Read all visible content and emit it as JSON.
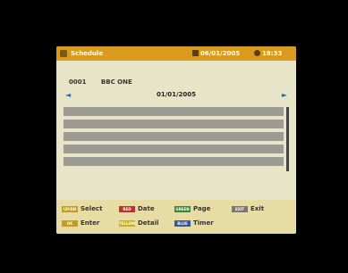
{
  "header": {
    "title": "Schedule",
    "date": "06/01/2005",
    "time": "18:33"
  },
  "channel": {
    "number": "0001",
    "name": "BBC ONE"
  },
  "date_nav": {
    "left_arrow": "◄",
    "date": "01/01/2005",
    "right_arrow": "►"
  },
  "schedule": {
    "rows": [
      "",
      "",
      "",
      "",
      "",
      ""
    ]
  },
  "legend": {
    "select": {
      "badge": "UP/DN",
      "label": "Select"
    },
    "date": {
      "badge": "RED",
      "label": "Date"
    },
    "page": {
      "badge": "GREEN",
      "label": "Page"
    },
    "exit": {
      "badge": "EXIT",
      "label": "Exit"
    },
    "enter": {
      "badge": "OK",
      "label": "Enter"
    },
    "detail": {
      "badge": "YELLOW",
      "label": "Detail"
    },
    "timer": {
      "badge": "BLUE",
      "label": "Timer"
    }
  },
  "colors": {
    "header_bg": "#d99a1e",
    "panel_bg": "#e8e4c8",
    "row_bg": "#9c9a92",
    "arrow": "#1b6fb8"
  }
}
